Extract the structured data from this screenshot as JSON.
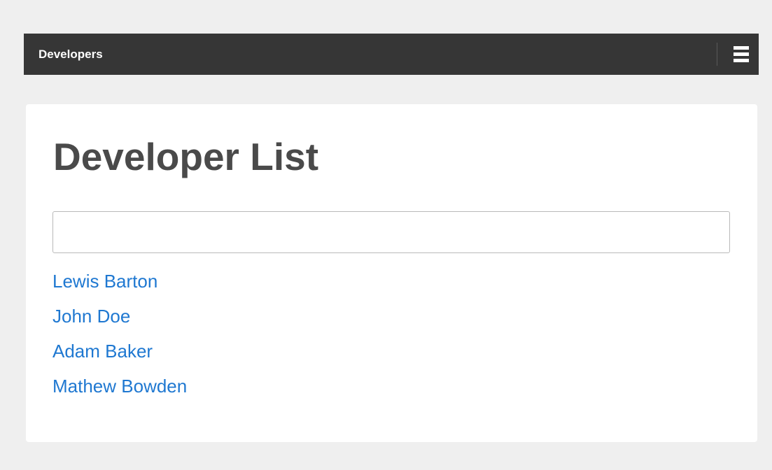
{
  "navbar": {
    "title": "Developers",
    "menu_icon": "hamburger-menu-icon"
  },
  "main": {
    "title": "Developer List",
    "search": {
      "value": "",
      "placeholder": ""
    },
    "developers": [
      "Lewis Barton",
      "John Doe",
      "Adam Baker",
      "Mathew Bowden"
    ]
  },
  "colors": {
    "navbar_bg": "#363636",
    "page_bg": "#efefef",
    "link": "#1f78d1",
    "title": "#4a4a4a"
  }
}
